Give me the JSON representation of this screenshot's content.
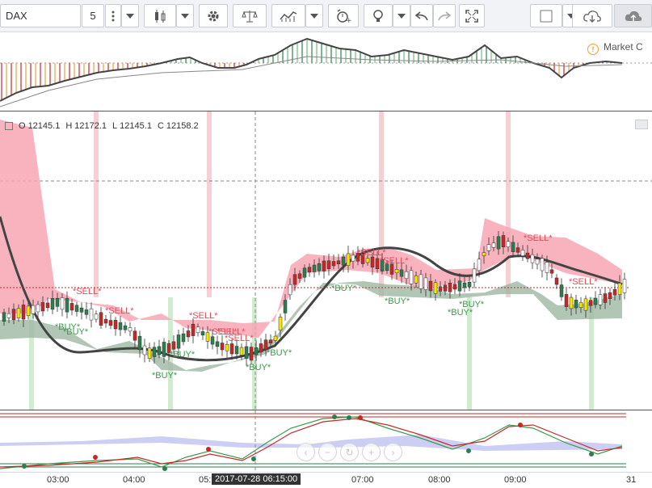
{
  "toolbar": {
    "symbol": "DAX",
    "interval": "5",
    "icons": [
      "more-vertical-icon",
      "chevron-down-icon",
      "candles-icon",
      "chevron-down-icon",
      "gear-icon",
      "scales-icon",
      "indicators-icon",
      "chevron-down-icon",
      "alarm-icon",
      "idea-icon",
      "undo-icon",
      "redo-icon",
      "fullscreen-icon",
      "template-icon",
      "chevron-down-icon",
      "cloud-download-icon",
      "cloud-upload-icon"
    ]
  },
  "ohlc": {
    "o_label": "O",
    "o": "12145.1",
    "h_label": "H",
    "h": "12172.1",
    "l_label": "L",
    "l": "12145.1",
    "c_label": "C",
    "c": "12158.2"
  },
  "market_status": "Market C",
  "time_axis": {
    "labels": [
      "03:00",
      "04:00",
      "05:",
      "07:00",
      "08:00",
      "09:00",
      "31"
    ],
    "cursor": "2017-07-28 06:15:00"
  },
  "signals": {
    "sell": [
      "*SELL*",
      "*SELL*",
      "*SELL*",
      "*SELL*",
      "*SELL*",
      "*SELL*",
      "*SELL*",
      "*SELL*",
      "*SELL*",
      "*SELL*"
    ],
    "buy": [
      "*BUY*",
      "*BUY*",
      "*BUY*",
      "*BUY*",
      "*BUY*",
      "*BUY*",
      "*BUY*",
      "*BUY*",
      "*BUY*",
      "*BUY*"
    ]
  },
  "colors": {
    "bull": "#2e7d4f",
    "bear": "#c62828",
    "cloud_red": "#f7a6b4",
    "cloud_green": "#9fb8a4",
    "sell_text": "#e24b5c",
    "buy_text": "#3a9a4a"
  }
}
